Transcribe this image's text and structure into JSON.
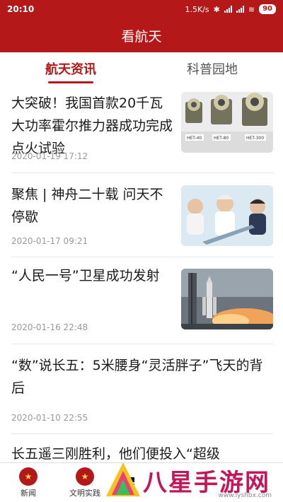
{
  "statusbar": {
    "time": "20:10",
    "speed": "1.5K/s",
    "battery": "90"
  },
  "header": {
    "title": "看航天"
  },
  "tabs": [
    {
      "label": "航天资讯",
      "active": true
    },
    {
      "label": "科普园地",
      "active": false
    }
  ],
  "articles": [
    {
      "title": "大突破！我国首款20千瓦大功率霍尔推力器成功完成点火试验",
      "date": "2020-01-19 17:12",
      "thumb_labels": [
        "HET-40",
        "HET-80",
        "HET-300"
      ]
    },
    {
      "title": "聚焦 | 神舟二十载 问天不停歇",
      "date": "2020-01-17 09:21"
    },
    {
      "title": "“人民一号”卫星成功发射",
      "date": "2020-01-16 22:48"
    },
    {
      "title": "“数”说长五：5米腰身“灵活胖子”飞天的背后",
      "date": "2020-01-10 22:55"
    },
    {
      "title": "长五遥三刚胜利，他们便投入“超级"
    }
  ],
  "bottom_nav": [
    {
      "label": "新闻",
      "icon": "news-icon"
    },
    {
      "label": "文明实践",
      "icon": "practice-icon"
    }
  ],
  "watermark": {
    "text": "八星手游网",
    "url": "www.lyshbx.com"
  }
}
